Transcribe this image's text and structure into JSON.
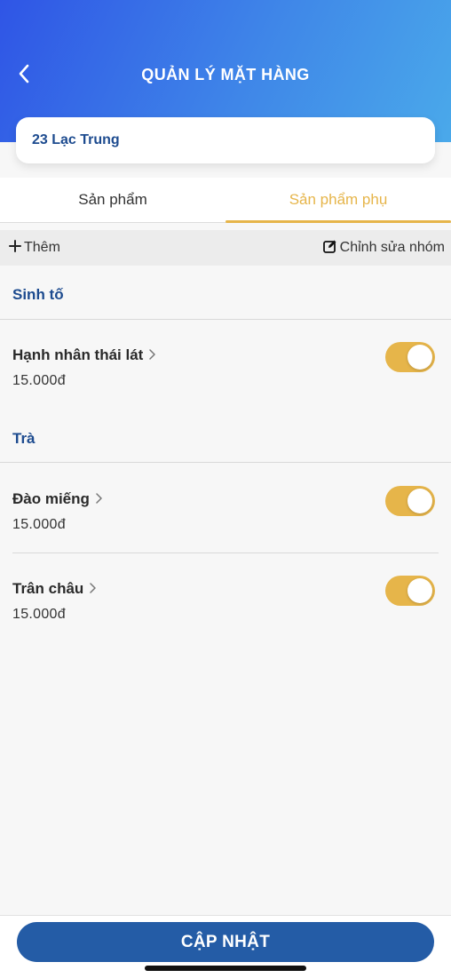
{
  "header": {
    "title": "QUẢN LÝ MẶT HÀNG",
    "back_icon": "chevron-left-icon"
  },
  "store": {
    "name": "23 Lạc Trung"
  },
  "tabs": [
    {
      "label": "Sản phẩm",
      "active": false
    },
    {
      "label": "Sản phẩm phụ",
      "active": true
    }
  ],
  "toolbar": {
    "add_label": "Thêm",
    "add_icon": "plus-icon",
    "edit_group_label": "Chỉnh sửa nhóm",
    "edit_icon": "edit-icon"
  },
  "groups": [
    {
      "title": "Sinh tố",
      "items": [
        {
          "name": "Hạnh nhân thái lát",
          "price": "15.000đ",
          "enabled": true
        }
      ]
    },
    {
      "title": "Trà",
      "items": [
        {
          "name": "Đào miếng",
          "price": "15.000đ",
          "enabled": true
        },
        {
          "name": "Trân châu",
          "price": "15.000đ",
          "enabled": true
        }
      ]
    }
  ],
  "footer": {
    "update_label": "CẬP NHẬT"
  },
  "colors": {
    "header_start": "#2f55e6",
    "header_end": "#4aa9ea",
    "accent": "#e6b54a",
    "primary": "#245ca6",
    "group_title": "#1d4b8f"
  }
}
